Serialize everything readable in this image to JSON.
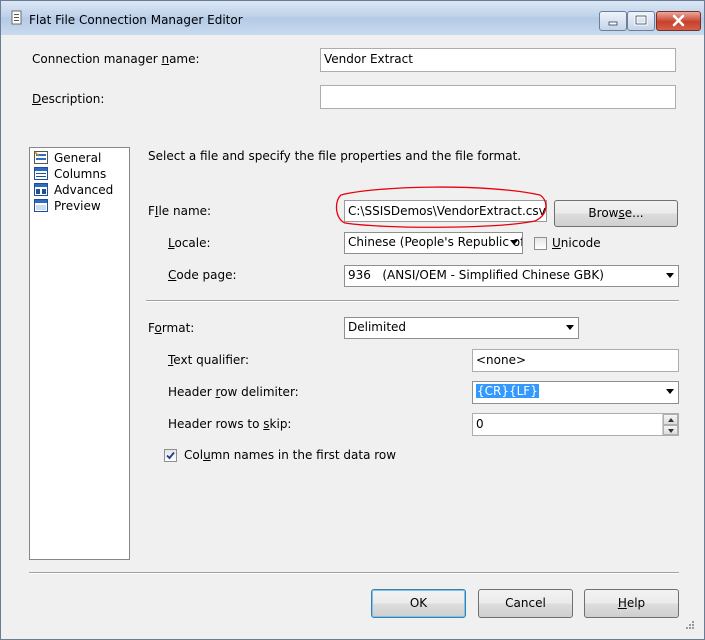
{
  "window": {
    "title": "Flat File Connection Manager Editor"
  },
  "connection_manager_name": {
    "label_pre": "Connection manager ",
    "label_u": "n",
    "label_post": "ame:",
    "value": "Vendor Extract"
  },
  "description": {
    "label_pre": "",
    "label_u": "D",
    "label_post": "escription:",
    "value": ""
  },
  "nav": {
    "items": [
      {
        "label": "General",
        "icon": "general-icon"
      },
      {
        "label": "Columns",
        "icon": "columns-icon"
      },
      {
        "label": "Advanced",
        "icon": "advanced-icon"
      },
      {
        "label": "Preview",
        "icon": "preview-icon"
      }
    ]
  },
  "instruction": "Select a file and specify the file properties and the file format.",
  "file_name": {
    "label_u": "I",
    "label_pre": "F",
    "label_post": "le name:",
    "value": "C:\\SSISDemos\\VendorExtract.csv",
    "highlight_color": "#e8000c"
  },
  "browse_button": {
    "label_pre": "Brow",
    "label_u": "s",
    "label_post": "e..."
  },
  "locale": {
    "label_pre": "",
    "label_u": "L",
    "label_post": "ocale:",
    "value": "Chinese (People's Republic of"
  },
  "unicode": {
    "label_pre": "",
    "label_u": "U",
    "label_post": "nicode",
    "checked": false
  },
  "code_page": {
    "label_pre": "",
    "label_u": "C",
    "label_post": "ode page:",
    "value": "936   (ANSI/OEM - Simplified Chinese GBK)"
  },
  "format": {
    "label_pre": "F",
    "label_u": "o",
    "label_post": "rmat:",
    "value": "Delimited"
  },
  "text_qualifier": {
    "label_pre": "",
    "label_u": "T",
    "label_post": "ext qualifier:",
    "value": "<none>"
  },
  "header_row_delimiter": {
    "label_pre": "Header ",
    "label_u": "r",
    "label_post": "ow delimiter:",
    "value": "{CR}{LF}"
  },
  "header_rows_to_skip": {
    "label_pre": "Header rows to ",
    "label_u": "s",
    "label_post": "kip:",
    "value": "0"
  },
  "column_names": {
    "label_pre": "Col",
    "label_u": "u",
    "label_post": "mn names in the first data row",
    "checked": true
  },
  "buttons": {
    "ok": "OK",
    "cancel": "Cancel",
    "help_pre": "",
    "help_u": "H",
    "help_post": "elp"
  }
}
